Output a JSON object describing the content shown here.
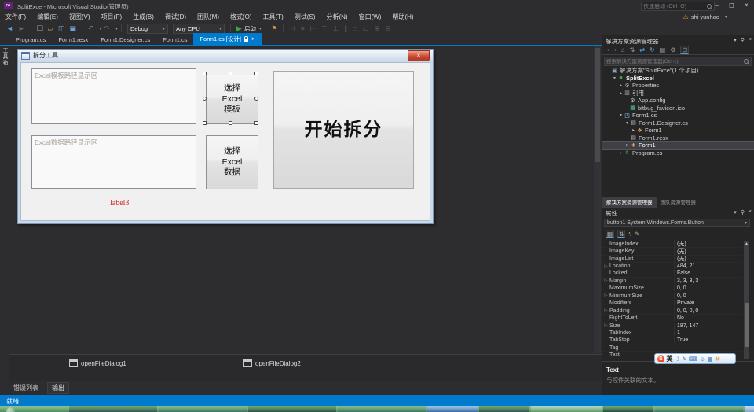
{
  "window": {
    "title": "SplitExce - Microsoft Visual Studio(管理员)",
    "quick_launch_placeholder": "快速启动 (Ctrl+Q)",
    "user": "shi yunhao",
    "minimize": "–",
    "restore": "◻",
    "close": "×"
  },
  "menu": {
    "items": [
      "文件(F)",
      "编辑(E)",
      "视图(V)",
      "项目(P)",
      "生成(B)",
      "调试(D)",
      "团队(M)",
      "格式(O)",
      "工具(T)",
      "测试(S)",
      "分析(N)",
      "窗口(W)",
      "帮助(H)"
    ]
  },
  "toolbar": {
    "debug_config": "Debug",
    "platform": "Any CPU",
    "start_label": "启动",
    "icons": {
      "back": "◄",
      "forward": "►",
      "new_file": "❏",
      "open": "▱",
      "save": "◫",
      "save_all": "▣",
      "undo": "↶",
      "redo": "↷",
      "play": "▶",
      "flag": "⚑",
      "align": [
        "⊣",
        "≡",
        "⊢",
        "⊤",
        "⊥",
        "∥",
        "□",
        "▭",
        "⊞",
        "⊟"
      ]
    }
  },
  "doc_tabs": [
    {
      "label": "Program.cs"
    },
    {
      "label": "Form1.resx"
    },
    {
      "label": "Form1.Designer.cs"
    },
    {
      "label": "Form1.cs"
    },
    {
      "label": "Form1.cs [设计]",
      "close": "×"
    }
  ],
  "left_strip": {
    "toolbox": "工具箱"
  },
  "designer": {
    "form_title": "拆分工具",
    "form_close": "×",
    "textbox_template": "Excel模板路径显示区",
    "textbox_data": "Excel数据路径显示区",
    "btn_template_lines": [
      "选择",
      "Excel",
      "模板"
    ],
    "btn_data_lines": [
      "选择",
      "Excel",
      "数据"
    ],
    "btn_start": "开始拆分",
    "label3": "label3"
  },
  "tray": {
    "items": [
      "openFileDialog1",
      "openFileDialog2"
    ]
  },
  "bottom_tabs": {
    "error_list": "错误列表",
    "output": "输出"
  },
  "status": {
    "ready": "就绪"
  },
  "solution_explorer": {
    "title": "解决方案资源管理器",
    "search_placeholder": "搜索解决方案资源管理器(Ctrl+;)",
    "header_icons": {
      "caret": "▾",
      "pin": "⚲",
      "close": "×"
    },
    "toolbar_icons": [
      "◦",
      "◦",
      "⌂",
      "⇅",
      "⇄",
      "↻",
      "▤",
      "⚙",
      "⊟"
    ],
    "tree": [
      {
        "label": "解决方案\"SplitExce\"(1 个项目)",
        "icon": "solution",
        "arrow": ""
      },
      {
        "label": "SplitExcel",
        "icon": "csharp-project",
        "arrow": "▾"
      },
      {
        "label": "Properties",
        "icon": "wrench",
        "arrow": "▸"
      },
      {
        "label": "引用",
        "icon": "references",
        "arrow": "▸"
      },
      {
        "label": "App.config",
        "icon": "config",
        "arrow": ""
      },
      {
        "label": "bitbug_favicon.ico",
        "icon": "image",
        "arrow": ""
      },
      {
        "label": "Form1.cs",
        "icon": "winform",
        "arrow": "▾"
      },
      {
        "label": "Form1.Designer.cs",
        "icon": "file",
        "arrow": "▾"
      },
      {
        "label": "Form1",
        "icon": "class",
        "arrow": "▸"
      },
      {
        "label": "Form1.resx",
        "icon": "file",
        "arrow": ""
      },
      {
        "label": "Form1",
        "icon": "class",
        "arrow": "▸"
      },
      {
        "label": "Program.cs",
        "icon": "csfile",
        "arrow": "▸"
      }
    ]
  },
  "panel_tabs": {
    "solution": "解决方案资源管理器",
    "team": "团队资源管理器"
  },
  "properties": {
    "title": "属性",
    "object": "button1 System.Windows.Forms.Button",
    "header_icons": {
      "caret": "▾",
      "pin": "⚲",
      "close": "×",
      "combo_caret": "▾"
    },
    "toolbar_icons": [
      "▦",
      "⇅",
      "ϟ",
      "✎"
    ],
    "rows": [
      {
        "name": "ImageIndex",
        "value": "(无)",
        "arrow": ""
      },
      {
        "name": "ImageKey",
        "value": "(无)",
        "arrow": ""
      },
      {
        "name": "ImageList",
        "value": "(无)",
        "arrow": ""
      },
      {
        "name": "Location",
        "value": "484, 21",
        "arrow": "▷"
      },
      {
        "name": "Locked",
        "value": "False",
        "arrow": ""
      },
      {
        "name": "Margin",
        "value": "3, 3, 3, 3",
        "arrow": "▷"
      },
      {
        "name": "MaximumSize",
        "value": "0, 0",
        "arrow": ""
      },
      {
        "name": "MinimumSize",
        "value": "0, 0",
        "arrow": "▷"
      },
      {
        "name": "Modifiers",
        "value": "Private",
        "arrow": ""
      },
      {
        "name": "Padding",
        "value": "0, 0, 0, 0",
        "arrow": "▷"
      },
      {
        "name": "RightToLeft",
        "value": "No",
        "arrow": ""
      },
      {
        "name": "Size",
        "value": "187, 147",
        "arrow": "▷"
      },
      {
        "name": "TabIndex",
        "value": "1",
        "arrow": ""
      },
      {
        "name": "TabStop",
        "value": "True",
        "arrow": ""
      },
      {
        "name": "Tag",
        "value": "",
        "arrow": ""
      },
      {
        "name": "Text",
        "value": "",
        "arrow": ""
      }
    ],
    "desc_title": "Text",
    "desc_text": "与控件关联的文本。"
  },
  "ime": {
    "logo": "S",
    "mode": "英",
    "icons": [
      "☽",
      "✎",
      "⌨",
      "☺",
      "▦"
    ],
    "tool_icon": "⚒"
  },
  "colors": {
    "accent": "#007ACC",
    "status_bar": "#007ACC",
    "label3_red": "#CC2222",
    "start_green": "#3BA447",
    "panel_bg": "#252526",
    "chrome_bg": "#2D2D30",
    "form_titlebar": "#D7E4F2",
    "taskbar_green": "#4F8F5F"
  }
}
